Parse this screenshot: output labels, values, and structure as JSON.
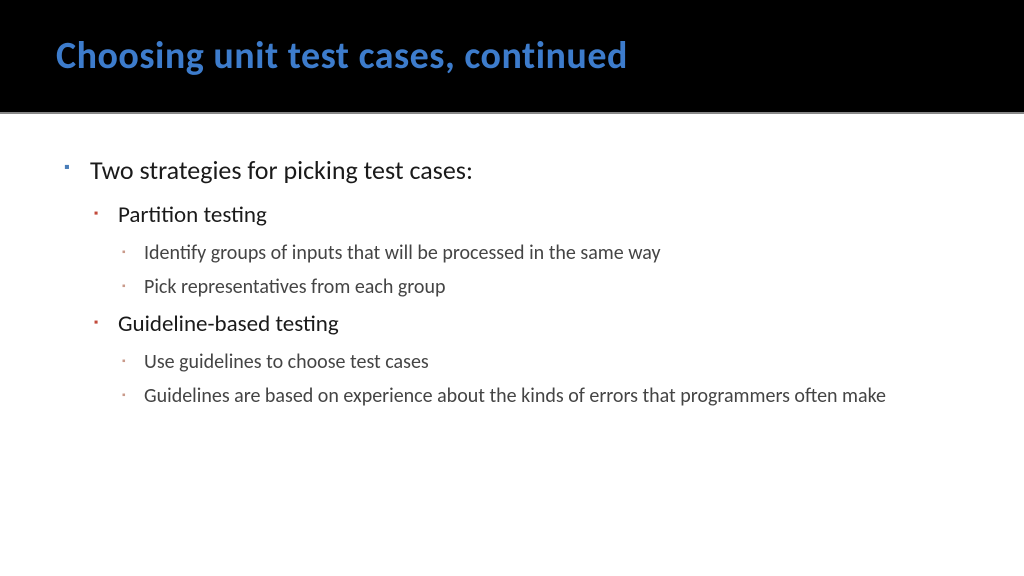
{
  "title": "Choosing unit test cases, continued",
  "content": {
    "main": "Two strategies for picking test cases:",
    "strategies": [
      {
        "name": "Partition testing",
        "points": [
          "Identify groups of inputs that will be processed in the same way",
          "Pick representatives from each group"
        ]
      },
      {
        "name": "Guideline-based testing",
        "points": [
          "Use guidelines to choose test cases",
          "Guidelines are based on experience about the kinds of errors that programmers often make"
        ]
      }
    ]
  }
}
